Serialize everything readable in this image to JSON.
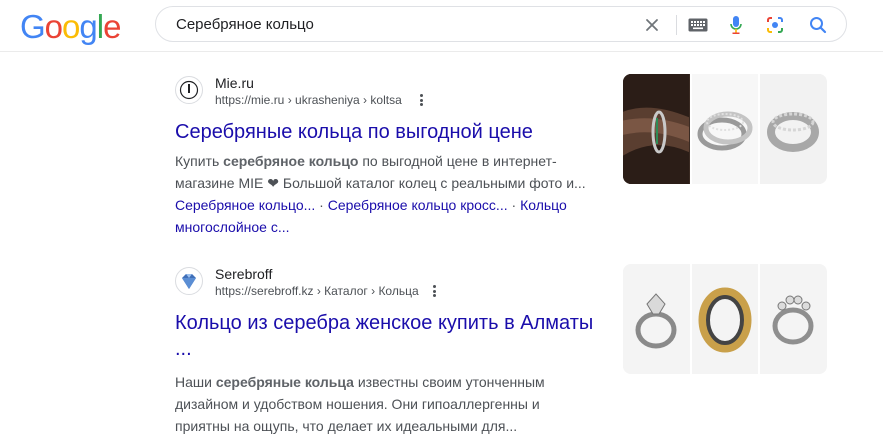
{
  "header": {
    "logo_letters": [
      "G",
      "o",
      "o",
      "g",
      "l",
      "e"
    ],
    "search_query": "Серебряное кольцо"
  },
  "icons": {
    "clear": "close-icon",
    "keyboard": "keyboard-icon",
    "voice": "microphone-icon",
    "lens": "camera-lens-icon",
    "search": "search-icon"
  },
  "colors": {
    "link": "#1a0dab",
    "snippet": "#4d5156",
    "google_blue": "#4285f4",
    "google_red": "#ea4335",
    "google_yellow": "#fbbc05",
    "google_green": "#34a853"
  },
  "results": [
    {
      "site_name": "Mie.ru",
      "url": "https://mie.ru › ukrasheniya › koltsa",
      "title": "Серебряные кольца по выгодной цене",
      "snippet_pre": "Купить ",
      "snippet_bold": "серебряное кольцо",
      "snippet_post": " по выгодной цене в интернет-магазине MIE ❤ Большой каталог колец с реальными фото и...",
      "sitelinks": [
        "Серебряное кольцо...",
        "Серебряное кольцо кросс...",
        "Кольцо многослойное с..."
      ],
      "sitelink_separator": " · "
    },
    {
      "site_name": "Serebroff",
      "url": "https://serebroff.kz › Каталог › Кольца",
      "title": "Кольцо из серебра женское купить в Алматы ...",
      "snippet_pre": "Наши ",
      "snippet_bold": "серебряные кольца",
      "snippet_post": " известны своим утонченным дизайном и удобством ношения. Они гипоаллергенны и приятны на ощупь, что делает их идеальными для..."
    }
  ]
}
